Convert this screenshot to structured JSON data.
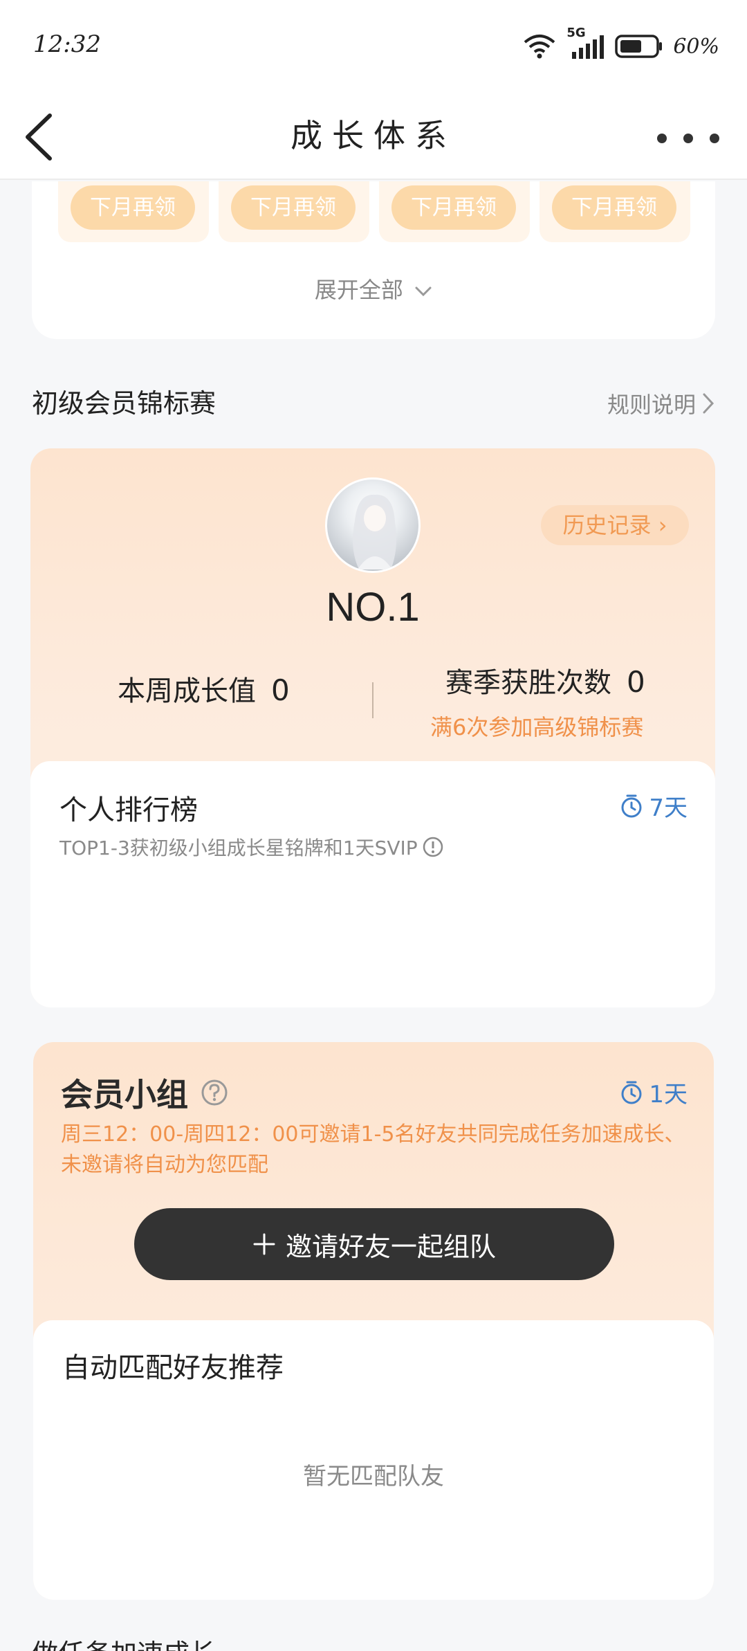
{
  "status_bar": {
    "time": "12:32",
    "network": "5G",
    "battery": "60%"
  },
  "header": {
    "title": "成长体系"
  },
  "rewards": {
    "buttons": [
      "下月再领",
      "下月再领",
      "下月再领",
      "下月再领"
    ],
    "expand_label": "展开全部"
  },
  "tournament": {
    "section_title": "初级会员锦标赛",
    "rules_label": "规则说明",
    "history_label": "历史记录",
    "rank": "NO.1",
    "weekly_growth_label": "本周成长值",
    "weekly_growth_value": "0",
    "season_wins_label": "赛季获胜次数",
    "season_wins_value": "0",
    "season_note": "满6次参加高级锦标赛",
    "leaderboard": {
      "title": "个人排行榜",
      "timer": "7天",
      "description": "TOP1-3获初级小组成长星铭牌和1天SVIP"
    }
  },
  "group": {
    "title": "会员小组",
    "timer": "1天",
    "description": "周三12：00-周四12：00可邀请1-5名好友共同完成任务加速成长、未邀请将自动为您匹配",
    "invite_label": "邀请好友一起组队",
    "match_title": "自动匹配好友推荐",
    "match_empty": "暂无匹配队友"
  },
  "next_section_title": "做任务加速成长",
  "colors": {
    "accent_orange": "#f0914a",
    "timer_blue": "#3f7fc9",
    "pill": "#fcd9a9",
    "button_dark": "#333333"
  }
}
